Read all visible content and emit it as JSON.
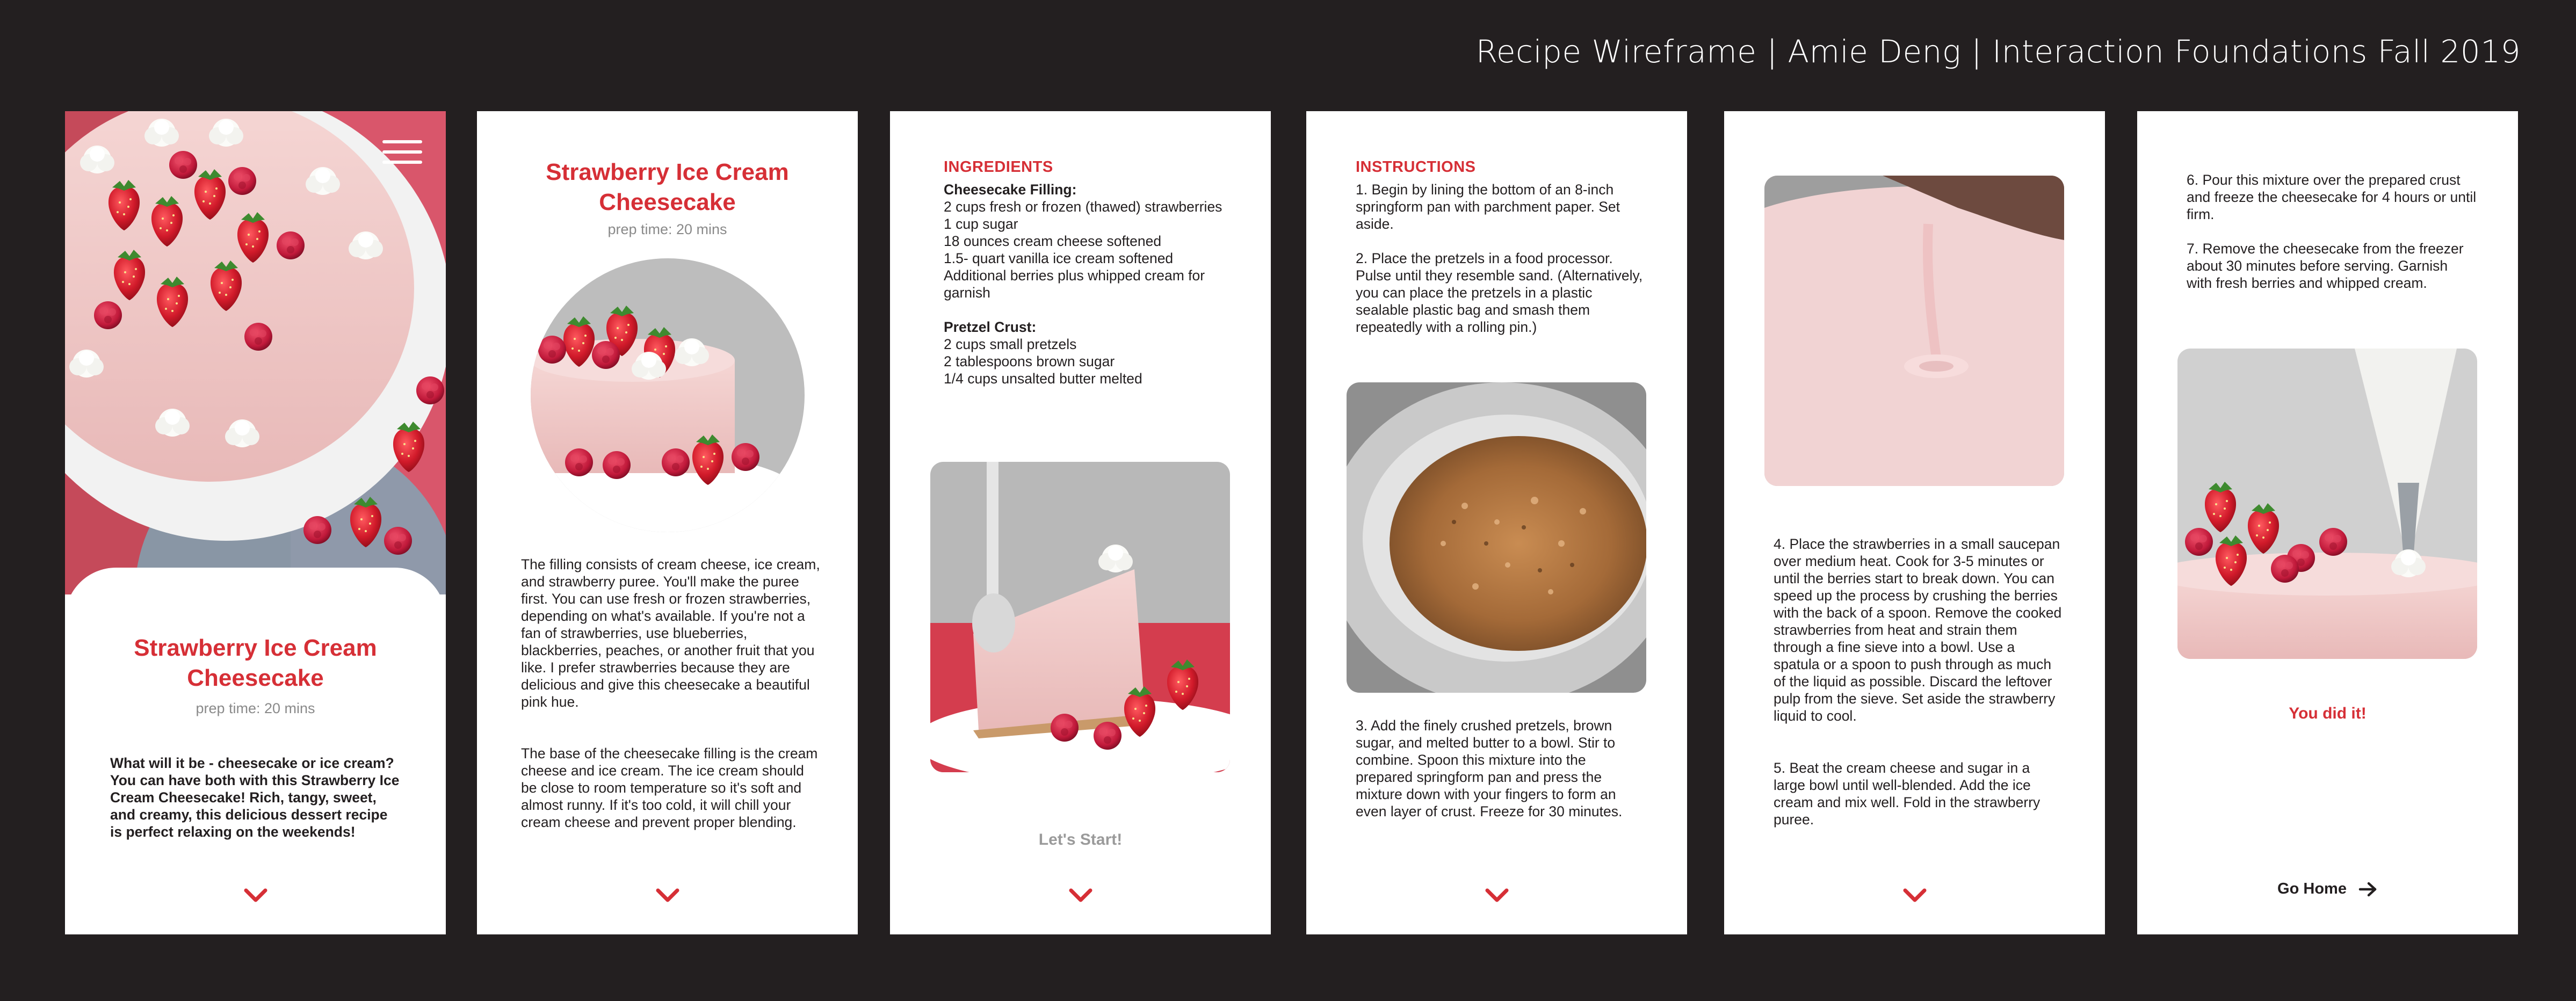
{
  "header": {
    "title": "Recipe Wireframe | Amie Deng | Interaction Foundations Fall 2019"
  },
  "screen1": {
    "title": "Strawberry Ice Cream Cheesecake",
    "prep": "prep time: 20 mins",
    "intro": "What will it be - cheesecake or ice cream? You can have both with this Strawberry Ice Cream Cheesecake! Rich, tangy, sweet, and creamy, this delicious dessert recipe is perfect relaxing on the weekends!",
    "menu_icon": "hamburger-menu-icon",
    "next_icon": "chevron-down-icon"
  },
  "screen2": {
    "title": "Strawberry Ice Cream Cheesecake",
    "prep": "prep time: 20 mins",
    "para1": "The filling consists of cream cheese, ice cream, and strawberry puree. You'll make the puree first. You can use fresh or frozen strawberries, depending on what's available. If you're not a fan of strawberries, use blueberries, blackberries, peaches, or another fruit that you like. I prefer strawberries because they are delicious and give this cheesecake a beautiful pink hue.",
    "para2": "The base of the cheesecake filling is the cream cheese and ice cream. The ice cream should be close to room temperature so it's soft and almost runny. If it's too cold, it will chill your cream cheese and prevent proper blending."
  },
  "screen3": {
    "heading": "INGREDIENTS",
    "filling_head": "Cheesecake Filling:",
    "filling_items": [
      "2 cups fresh or frozen (thawed) strawberries",
      "1 cup sugar",
      "18 ounces cream cheese softened",
      "1.5- quart vanilla ice cream softened",
      "Additional berries plus whipped cream for garnish"
    ],
    "crust_head": "Pretzel Crust:",
    "crust_items": [
      "2 cups small pretzels",
      "2 tablespoons brown sugar",
      "1/4 cups unsalted butter melted"
    ],
    "cta": "Let's Start!"
  },
  "screen4": {
    "heading": "INSTRUCTIONS",
    "step1": "1. Begin by lining the bottom of an 8-inch springform pan with parchment paper. Set aside.",
    "step2": "2. Place the pretzels in a food processor. Pulse until they resemble sand. (Alternatively, you can place the pretzels in a plastic sealable plastic bag and smash them repeatedly with a rolling pin.)",
    "step3": "3. Add the finely crushed pretzels, brown sugar, and melted butter to a bowl. Stir to combine. Spoon this mixture into the prepared springform pan and press the mixture down with your fingers to form an even layer of crust. Freeze for 30 minutes."
  },
  "screen5": {
    "step4": "4. Place the strawberries in a small saucepan over medium heat. Cook for 3-5 minutes or until the berries start to break down. You can speed up the process by crushing the berries with the back of a spoon. Remove the cooked strawberries from heat and strain them through a fine sieve into a bowl. Use a spatula or a spoon to push through as much of the liquid as possible. Discard the leftover pulp from the sieve. Set aside the strawberry liquid to cool.",
    "step5": "5. Beat the cream cheese and sugar in a large bowl until well-blended. Add the ice cream and mix well. Fold in the strawberry puree."
  },
  "screen6": {
    "step6": "6. Pour this mixture over the prepared crust and freeze the cheesecake for 4 hours or until firm.",
    "step7": "7. Remove the cheesecake from the freezer about 30 minutes before serving. Garnish with fresh berries and whipped cream.",
    "done": "You did it!",
    "home": "Go Home"
  },
  "colors": {
    "accent": "#d62f36",
    "background": "#231f20",
    "card": "#ffffff",
    "muted": "#8a8a8a"
  }
}
